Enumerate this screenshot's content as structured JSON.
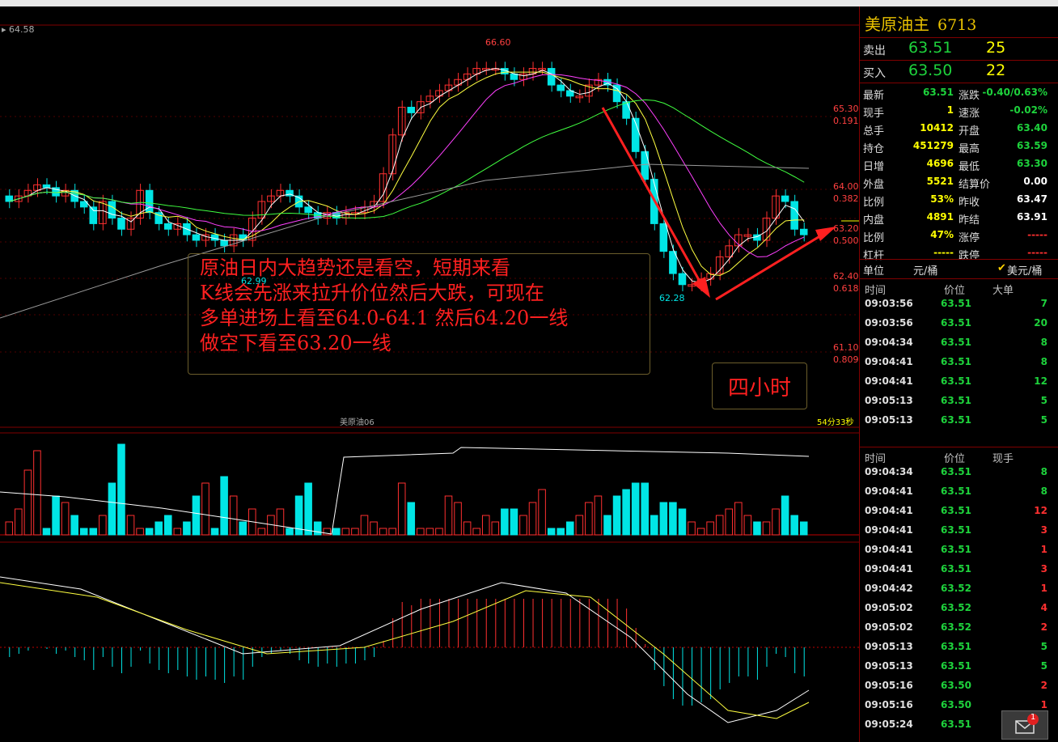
{
  "top_left_label": "64.58",
  "colors": {
    "up": "#ff3030",
    "down": "#00e5e5",
    "ma5": "#ffffff",
    "ma10": "#ffff40",
    "ma20": "#ff40ff",
    "ma60": "#40ff40",
    "ma_long": "#9a9a9a",
    "panel_border": "#800000",
    "price_green": "#1ed23c",
    "price_yellow": "#ffff00"
  },
  "chart": {
    "price_labels": [
      "66.60",
      "62.99",
      "62.28"
    ],
    "right_levels": [
      {
        "price": "65.30",
        "ratio": "0.191"
      },
      {
        "price": "64.00",
        "ratio": "0.382"
      },
      {
        "price": "63.20",
        "ratio": "0.500"
      },
      {
        "price": "62.40",
        "ratio": "0.618"
      },
      {
        "price": "61.10",
        "ratio": "0.809"
      }
    ],
    "instrument_tag": "美原油06",
    "countdown": "54分33秒"
  },
  "annotation": {
    "lines": [
      "原油日内大趋势还是看空，短期来看",
      "K线会先涨来拉升价位然后大跌，可现在",
      "多单进场上看至64.0-64.1 然后64.20一线",
      "做空下看至63.20一线"
    ],
    "timeframe": "四小时"
  },
  "quote": {
    "title": "美原油主",
    "code": "6713",
    "sell": {
      "label": "卖出",
      "price": "63.51",
      "qty": "25"
    },
    "buy": {
      "label": "买入",
      "price": "63.50",
      "qty": "22"
    },
    "stats": [
      {
        "l1": "最新",
        "v1": "63.51",
        "l2": "涨跌",
        "v2": "-0.40/0.63%"
      },
      {
        "l1": "现手",
        "v1": "1",
        "l2": "速涨",
        "v2": "-0.02%"
      },
      {
        "l1": "总手",
        "v1": "10412",
        "l2": "开盘",
        "v2": "63.40"
      },
      {
        "l1": "持仓",
        "v1": "451279",
        "l2": "最高",
        "v2": "63.59"
      },
      {
        "l1": "日增",
        "v1": "4696",
        "l2": "最低",
        "v2": "63.30"
      },
      {
        "l1": "外盘",
        "v1": "5521",
        "l2": "结算价",
        "v2": "0.00"
      },
      {
        "l1": "比例",
        "v1": "53%",
        "l2": "昨收",
        "v2": "63.47"
      },
      {
        "l1": "内盘",
        "v1": "4891",
        "l2": "昨结",
        "v2": "63.91"
      },
      {
        "l1": "比例",
        "v1": "47%",
        "l2": "涨停",
        "v2": "-----"
      },
      {
        "l1": "杠杆",
        "v1": "-----",
        "l2": "跌停",
        "v2": "-----"
      }
    ],
    "unit_label": "单位",
    "unit_value": "元/桶",
    "unit_option": "美元/桶"
  },
  "big_trades": {
    "headers": [
      "时间",
      "价位",
      "大单"
    ],
    "rows": [
      {
        "time": "09:03:56",
        "price": "63.51",
        "vol": "7"
      },
      {
        "time": "09:03:56",
        "price": "63.51",
        "vol": "20"
      },
      {
        "time": "09:04:34",
        "price": "63.51",
        "vol": "8"
      },
      {
        "time": "09:04:41",
        "price": "63.51",
        "vol": "8"
      },
      {
        "time": "09:04:41",
        "price": "63.51",
        "vol": "12"
      },
      {
        "time": "09:05:13",
        "price": "63.51",
        "vol": "5"
      },
      {
        "time": "09:05:13",
        "price": "63.51",
        "vol": "5"
      }
    ]
  },
  "ticks": {
    "headers": [
      "时间",
      "价位",
      "现手"
    ],
    "rows": [
      {
        "time": "09:04:34",
        "price": "63.51",
        "vol": "8"
      },
      {
        "time": "09:04:41",
        "price": "63.51",
        "vol": "8"
      },
      {
        "time": "09:04:41",
        "price": "63.51",
        "vol": "12"
      },
      {
        "time": "09:04:41",
        "price": "63.51",
        "vol": "3"
      },
      {
        "time": "09:04:41",
        "price": "63.51",
        "vol": "1"
      },
      {
        "time": "09:04:41",
        "price": "63.51",
        "vol": "3"
      },
      {
        "time": "09:04:42",
        "price": "63.52",
        "vol": "1"
      },
      {
        "time": "09:05:02",
        "price": "63.52",
        "vol": "4"
      },
      {
        "time": "09:05:02",
        "price": "63.52",
        "vol": "2"
      },
      {
        "time": "09:05:13",
        "price": "63.51",
        "vol": "5"
      },
      {
        "time": "09:05:13",
        "price": "63.51",
        "vol": "5"
      },
      {
        "time": "09:05:16",
        "price": "63.50",
        "vol": "2"
      },
      {
        "time": "09:05:16",
        "price": "63.50",
        "vol": "1"
      },
      {
        "time": "09:05:24",
        "price": "63.51",
        "vol": ""
      }
    ]
  },
  "mail_badge": "1"
}
